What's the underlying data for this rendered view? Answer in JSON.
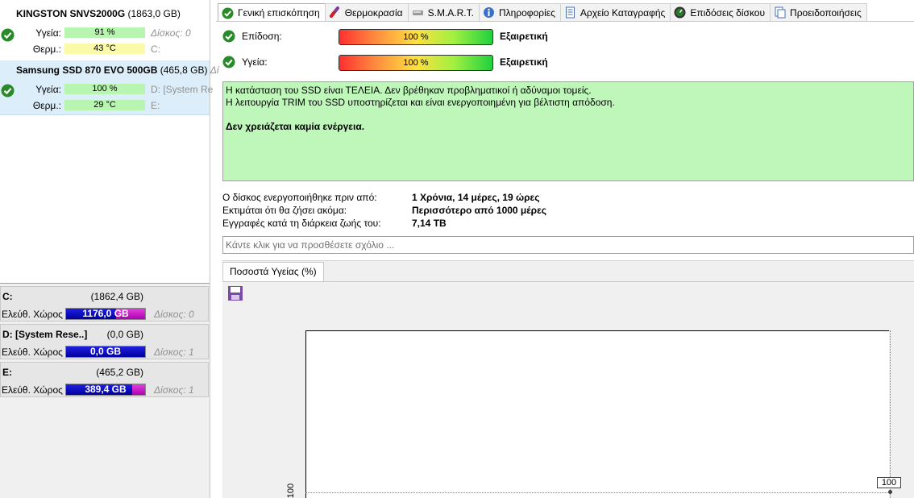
{
  "disks": [
    {
      "name": "KINGSTON SNVS2000G",
      "capacity": "(1863,0 GB)",
      "health_label": "Υγεία:",
      "health": "91 %",
      "health_value": 91,
      "health_disk": "Δίσκος: 0",
      "temp_label": "Θερμ.:",
      "temp": "43 °C",
      "temp_drive": "C:"
    },
    {
      "name": "Samsung SSD 870 EVO 500GB",
      "capacity": "(465,8 GB)",
      "capacity_extra": "Δί",
      "health_label": "Υγεία:",
      "health": "100 %",
      "health_value": 100,
      "health_drive": "D: [System Re",
      "temp_label": "Θερμ.:",
      "temp": "29 °C",
      "temp_drive": "E:"
    }
  ],
  "volumes": [
    {
      "name": "C:",
      "size": "(1862,4 GB)",
      "free_label": "Ελεύθ. Χώρος",
      "free": "1176,0 GB",
      "free_ratio": 0.63,
      "disk": "Δίσκος: 0"
    },
    {
      "name": "D: [System Rese..]",
      "size": "(0,0 GB)",
      "free_label": "Ελεύθ. Χώρος",
      "free": "0,0 GB",
      "free_ratio": 1.0,
      "disk": "Δίσκος: 1"
    },
    {
      "name": "E:",
      "size": "(465,2 GB)",
      "free_label": "Ελεύθ. Χώρος",
      "free": "389,4 GB",
      "free_ratio": 0.84,
      "disk": "Δίσκος: 1"
    }
  ],
  "tabs": [
    {
      "label": "Γενική επισκόπηση",
      "icon": "checkmark-icon",
      "active": true
    },
    {
      "label": "Θερμοκρασία",
      "icon": "thermometer-icon"
    },
    {
      "label": "S.M.A.R.T.",
      "icon": "drive-icon"
    },
    {
      "label": "Πληροφορίες",
      "icon": "info-icon"
    },
    {
      "label": "Αρχείο Καταγραφής",
      "icon": "log-icon"
    },
    {
      "label": "Επιδόσεις δίσκου",
      "icon": "gauge-icon"
    },
    {
      "label": "Προειδοποιήσεις",
      "icon": "alert-icon"
    }
  ],
  "overview": {
    "performance_label": "Επίδοση:",
    "performance": "100 %",
    "performance_verdict": "Εξαιρετική",
    "health_label": "Υγεία:",
    "health": "100 %",
    "health_verdict": "Εξαιρετική",
    "status_line1": "Η κατάσταση του SSD είναι ΤΕΛΕΙΑ. Δεν βρέθηκαν προβληματικοί ή αδύναμοι τομείς.",
    "status_line2": "Η λειτουργία TRIM του SSD υποστηρίζεται και είναι ενεργοποιημένη για βέλτιστη απόδοση.",
    "status_action": "Δεν χρειάζεται καμία ενέργεια.",
    "powered_label": "Ο δίσκος ενεργοποιήθηκε πριν από:",
    "powered": "1 Χρόνια, 14 μέρες, 19 ώρες",
    "lifetime_label": "Εκτιμάται ότι θα ζήσει ακόμα:",
    "lifetime": "Περισσότερο από 1000 μέρες",
    "written_label": "Εγγραφές κατά τη διάρκεια ζωής του:",
    "written": "7,14 TB",
    "comment_placeholder": "Κάντε κλικ για να προσθέσετε σχόλιο ..."
  },
  "chart_tab": "Ποσοστά Υγείας (%)",
  "chart_data": {
    "type": "line",
    "title": "",
    "series": [
      {
        "values": [
          100
        ]
      }
    ],
    "ytick": "100",
    "point_label": "100"
  },
  "colors": {
    "ok_green": "#2a8a2a",
    "status_bg": "#bff7bb",
    "selected_row": "#dbeefa"
  }
}
